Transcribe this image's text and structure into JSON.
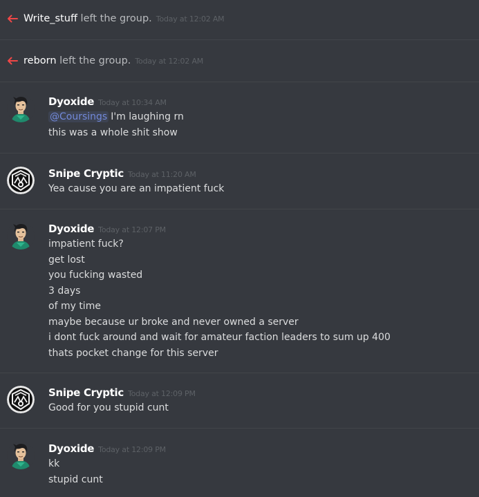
{
  "system_messages": [
    {
      "user": "Write_stuff",
      "action": " left the group.",
      "time": "Today at 12:02 AM"
    },
    {
      "user": "reborn",
      "action": " left the group.",
      "time": "Today at 12:02 AM"
    }
  ],
  "messages": [
    {
      "author": "Dyoxide",
      "time": "Today at 10:34 AM",
      "mention": "@Coursings",
      "first_line_rest": "I'm laughing rn",
      "lines": [
        "this was a whole shit show"
      ]
    },
    {
      "author": "Snipe Cryptic",
      "time": "Today at 11:20 AM",
      "lines": [
        "Yea cause you are an impatient fuck"
      ]
    },
    {
      "author": "Dyoxide",
      "time": "Today at 12:07 PM",
      "lines": [
        "impatient fuck?",
        "get lost",
        "you fucking wasted",
        "3 days",
        "of my time",
        "maybe because ur broke and never owned a server",
        "i dont fuck around and wait for amateur faction leaders to sum up 400",
        "thats pocket change for this server"
      ]
    },
    {
      "author": "Snipe Cryptic",
      "time": "Today at 12:09 PM",
      "lines": [
        "Good for you stupid cunt"
      ]
    },
    {
      "author": "Dyoxide",
      "time": "Today at 12:09 PM",
      "lines": [
        "kk",
        "stupid cunt"
      ]
    }
  ],
  "colors": {
    "background": "#36393f",
    "leave_arrow": "#f04747",
    "mention": "#7289da"
  }
}
